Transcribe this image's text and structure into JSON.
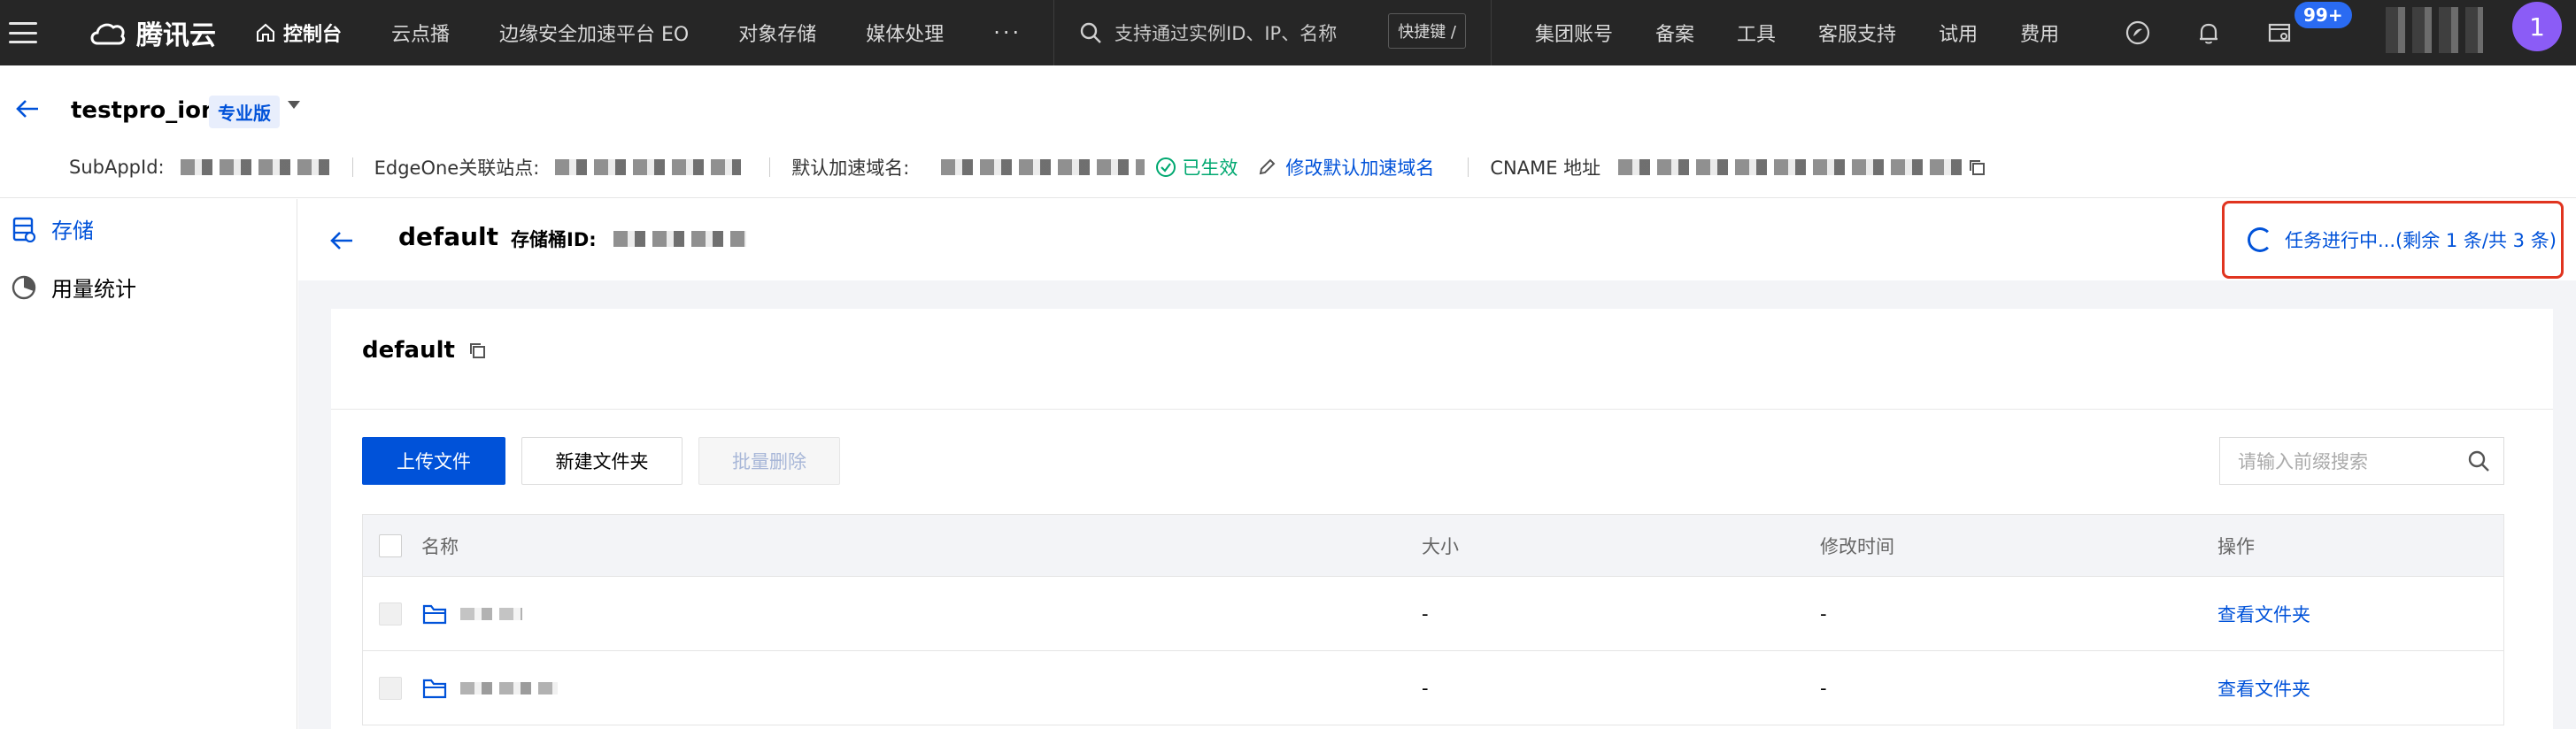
{
  "topbar": {
    "logo_text": "腾讯云",
    "console_label": "控制台",
    "nav": [
      "云点播",
      "边缘安全加速平台 EO",
      "对象存储",
      "媒体处理"
    ],
    "more": "···",
    "search_placeholder": "支持通过实例ID、IP、名称",
    "search_shortcut": "快捷键 /",
    "right_nav": [
      "集团账号",
      "备案",
      "工具",
      "客服支持",
      "试用",
      "费用"
    ],
    "notification_count": "99+",
    "avatar_initial": "1"
  },
  "header": {
    "instance_name": "testpro_ion",
    "edition_badge": "专业版",
    "subappid_label": "SubAppId:",
    "edgeone_label": "EdgeOne关联站点:",
    "default_domain_label": "默认加速域名:",
    "status_text": "已生效",
    "modify_domain_link": "修改默认加速域名",
    "cname_label": "CNAME 地址"
  },
  "sidebar": {
    "items": [
      {
        "label": "存储",
        "active": true
      },
      {
        "label": "用量统计",
        "active": false
      }
    ]
  },
  "bucket": {
    "name": "default",
    "id_label": "存储桶ID:",
    "task_status": "任务进行中...(剩余 1 条/共 3 条)"
  },
  "card": {
    "title": "default",
    "upload_button": "上传文件",
    "new_folder_button": "新建文件夹",
    "batch_delete_button": "批量删除",
    "search_placeholder": "请输入前缀搜索"
  },
  "table": {
    "columns": [
      "名称",
      "大小",
      "修改时间",
      "操作"
    ],
    "rows": [
      {
        "size": "-",
        "modified": "-",
        "action": "查看文件夹"
      },
      {
        "size": "-",
        "modified": "-",
        "action": "查看文件夹"
      }
    ]
  },
  "colors": {
    "primary": "#0052d9",
    "topbar_bg": "#262626",
    "success": "#00a870",
    "highlight_border": "#e0341f",
    "avatar_bg": "#8b5cf6"
  }
}
